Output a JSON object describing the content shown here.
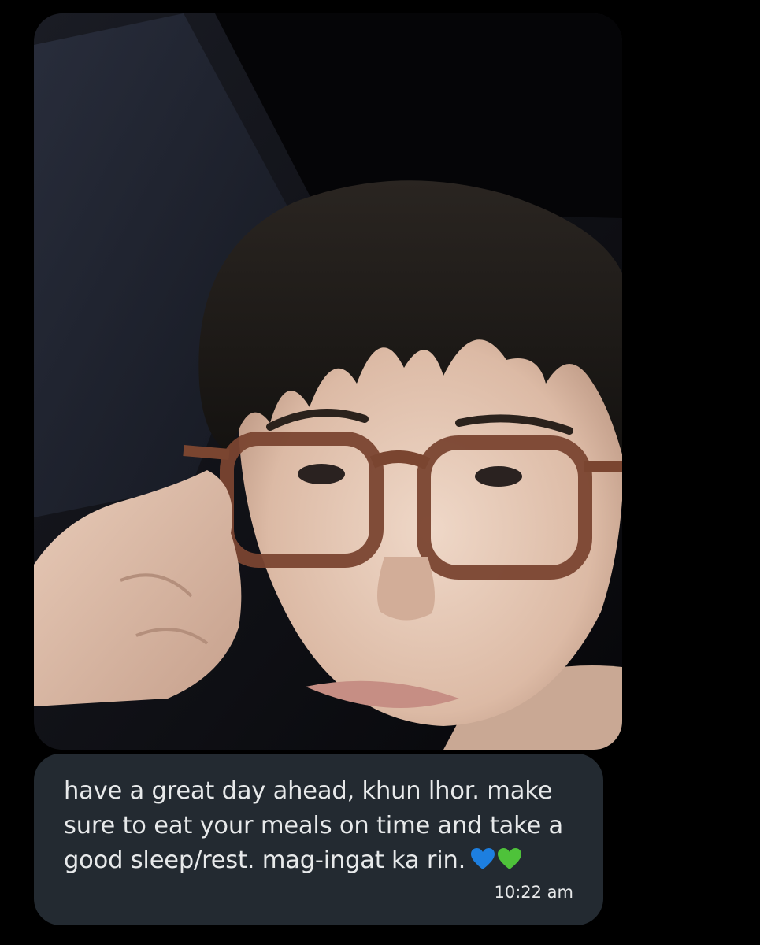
{
  "message": {
    "photo_alt": "selfie photo",
    "text": "have a great day ahead, khun lhor. make sure to eat your meals on time and take a good sleep/rest. mag-ingat ka rin.",
    "emojis": [
      "blue-heart",
      "green-heart"
    ],
    "timestamp": "10:22 am"
  },
  "colors": {
    "background": "#000000",
    "bubble": "#232a31",
    "text": "#e7e9ea",
    "blue_heart": "#1d7fe0",
    "green_heart": "#4ec23a"
  }
}
